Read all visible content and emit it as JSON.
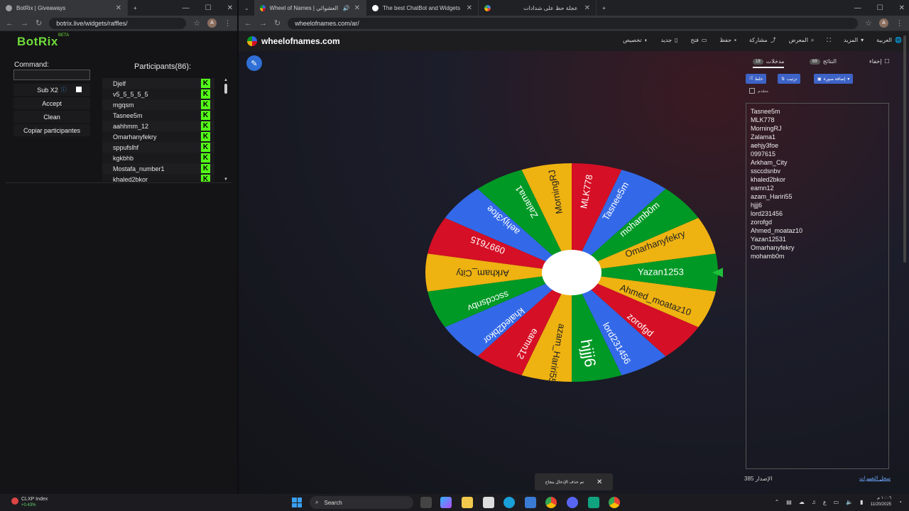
{
  "left_window": {
    "tab": {
      "title": "BotRix | Giveaways"
    },
    "url": "botrix.live/widgets/raffles/",
    "profile_initial": "A"
  },
  "botrix": {
    "logo": "BotRix",
    "beta": "BETA",
    "command_label": "Command:",
    "command_value": "",
    "sub_label": "Sub X2",
    "accept": "Accept",
    "clean": "Clean",
    "copy": "Copiar participantes",
    "participants_title": "Participants(86):",
    "participants": [
      "Djelf",
      "v5_5_5_5_5",
      "mgqsm",
      "Tasnee5m",
      "aahhmm_12",
      "Omarhanyfekry",
      "sppufslhf",
      "kgkbhb",
      "Mostafa_number1",
      "khaled2bkor"
    ],
    "platform_badge": "K",
    "kick_color": "#53fc18"
  },
  "right_window": {
    "tabs": [
      {
        "title": "Wheel of Names | عجلة العشوائي"
      },
      {
        "title": "The best ChatBot and Widgets"
      },
      {
        "title": "عجلة حظ على شدادات"
      }
    ],
    "url": "wheelofnames.com/ar/",
    "profile_initial": "A"
  },
  "won": {
    "site": "wheelofnames.com",
    "menu": [
      "تخصيص",
      "جديد",
      "فتح",
      "حفظ",
      "مشاركة",
      "المعرض",
      "المزيد",
      "العربية"
    ],
    "side": {
      "tab_entries": "مدخلات",
      "entries_count": "18",
      "tab_results": "النتائج",
      "results_count": "69",
      "hide": "إخفاء",
      "shuffle": "خلط",
      "sort": "ترتيب",
      "add_image": "إضافة صورة",
      "advanced": "متقدم",
      "version_label": "الإصدار",
      "version": "385",
      "changes": "سجل التغييرات"
    },
    "entries": [
      "Tasnee5m",
      "MLK778",
      "MorningRJ",
      "Zalama1",
      "aehjy3foe",
      "0997615",
      "Arkham_City",
      "ssccdsnbv",
      "khaled2bkor",
      "eamn12",
      "azam_Hariri55",
      "hjjj6",
      "lord231456",
      "zorofgd",
      "Ahmed_moataz10",
      "Yazan12531",
      "Omarhanyfekry",
      "mohamb0m"
    ],
    "wheel_labels": [
      "Yazan1253",
      "Ahmed_moataz10",
      "zorofgd",
      "lord231456",
      "hjjj6",
      "azam_Hariri55",
      "eamn12",
      "khaled2bkor",
      "ssccdsnbv",
      "Arkham_City",
      "0997615",
      "aehjy3foe",
      "Zalama1",
      "MorningRJ",
      "MLK778",
      "Tasnee5m",
      "mohamb0m",
      "Omarhanyfekry"
    ],
    "wheel_colors": [
      "#009925",
      "#eeb211",
      "#d50f25",
      "#3369e8"
    ],
    "pointer_color": "#1fbf3a",
    "toast": "تم حذف الإدخال بنجاح"
  },
  "taskbar": {
    "ticker_name": "CLXP Index",
    "ticker_change": "+0.43%",
    "search": "Search",
    "time": "١٠:٠٦ م",
    "date": "11/20/2025",
    "lang": "ع"
  }
}
